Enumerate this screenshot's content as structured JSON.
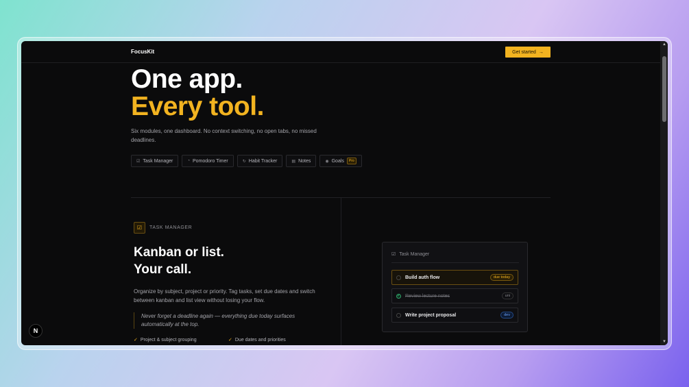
{
  "header": {
    "logo": "FocusKit",
    "cta_label": "Get started",
    "cta_arrow": "→"
  },
  "hero": {
    "line1": "One app.",
    "line2": "Every tool.",
    "subtitle": "Six modules, one dashboard. No context switching, no open tabs, no missed deadlines."
  },
  "modules": [
    {
      "label": "Task Manager",
      "icon": "checkbox-icon"
    },
    {
      "label": "Pomodoro Timer",
      "icon": "timer-icon"
    },
    {
      "label": "Habit Tracker",
      "icon": "repeat-icon"
    },
    {
      "label": "Notes",
      "icon": "note-icon"
    },
    {
      "label": "Goals",
      "icon": "target-icon",
      "badge": "Pro"
    }
  ],
  "section": {
    "label": "TASK MANAGER",
    "title1": "Kanban or list.",
    "title2": "Your call.",
    "description": "Organize by subject, project or priority. Tag tasks, set due dates and switch between kanban and list view without losing your flow.",
    "quote": "Never forget a deadline again — everything due today surfaces automatically at the top.",
    "features": [
      "Project & subject grouping",
      "Due dates and priorities"
    ]
  },
  "panel": {
    "title": "Task Manager",
    "tasks": [
      {
        "label": "Build auth flow",
        "tag": "due today",
        "done": false
      },
      {
        "label": "Review lecture notes",
        "tag": "uni",
        "done": true
      },
      {
        "label": "Write project proposal",
        "tag": "dev",
        "done": false
      }
    ]
  },
  "badge": {
    "letter": "N"
  },
  "colors": {
    "accent": "#f2b320",
    "background": "#0b0b0c",
    "success": "#3ccf86",
    "info": "#6aa3ff"
  }
}
